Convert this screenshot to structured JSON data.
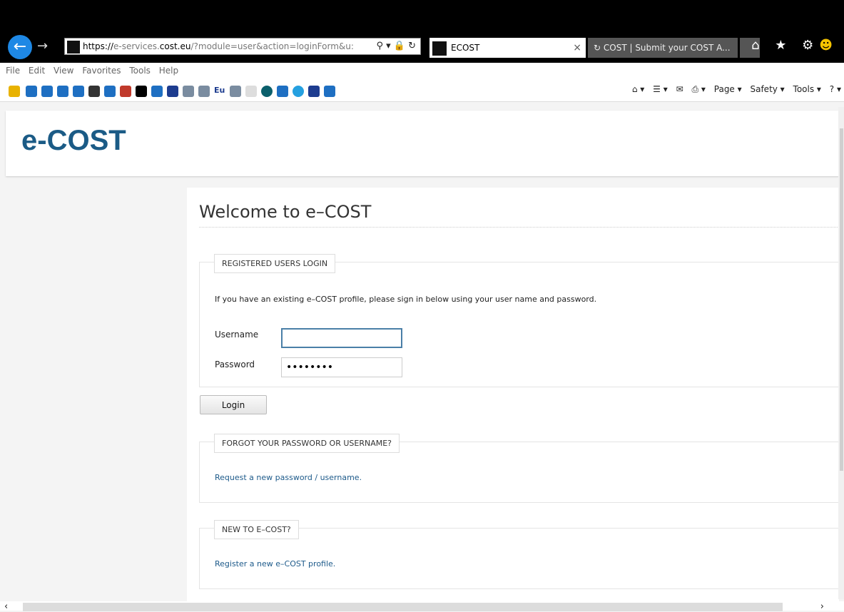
{
  "browser": {
    "url_scheme": "https://",
    "url_host_dim": "e-services.",
    "url_host": "cost.eu",
    "url_path": "/?module=user&action=loginForm&u:",
    "addr_tools": "⚲ ▾ 🔒 ↻",
    "tab_active_title": "ECOST",
    "tab_inactive_title": "COST | Submit your COST A...",
    "tab_close": "×",
    "nav_icons": "⌂ ★ ⚙",
    "smiley": "☻"
  },
  "menubar": [
    "File",
    "Edit",
    "View",
    "Favorites",
    "Tools",
    "Help"
  ],
  "commandbar": {
    "home": "⌂ ▾",
    "feeds": "☰ ▾",
    "mail": "✉",
    "print": "⎙ ▾",
    "page": "Page ▾",
    "safety": "Safety ▾",
    "tools": "Tools ▾",
    "help": "? ▾"
  },
  "site": {
    "logo": "e-COST"
  },
  "login": {
    "welcome": "Welcome to e–COST",
    "registered_legend": "REGISTERED USERS LOGIN",
    "intro": "If you have an existing e–COST profile, please sign in below using your user name and password.",
    "username_label": "Username",
    "username_value": "",
    "password_label": "Password",
    "password_value": "••••••••",
    "login_button": "Login",
    "forgot_legend": "FORGOT YOUR PASSWORD OR USERNAME?",
    "forgot_link": "Request a new password / username.",
    "new_legend": "NEW TO E–COST?",
    "register_link": "Register a new e–COST profile."
  },
  "colors": {
    "brand": "#1b5b86",
    "link": "#1d5a8a",
    "focus": "#4a7fa7"
  }
}
